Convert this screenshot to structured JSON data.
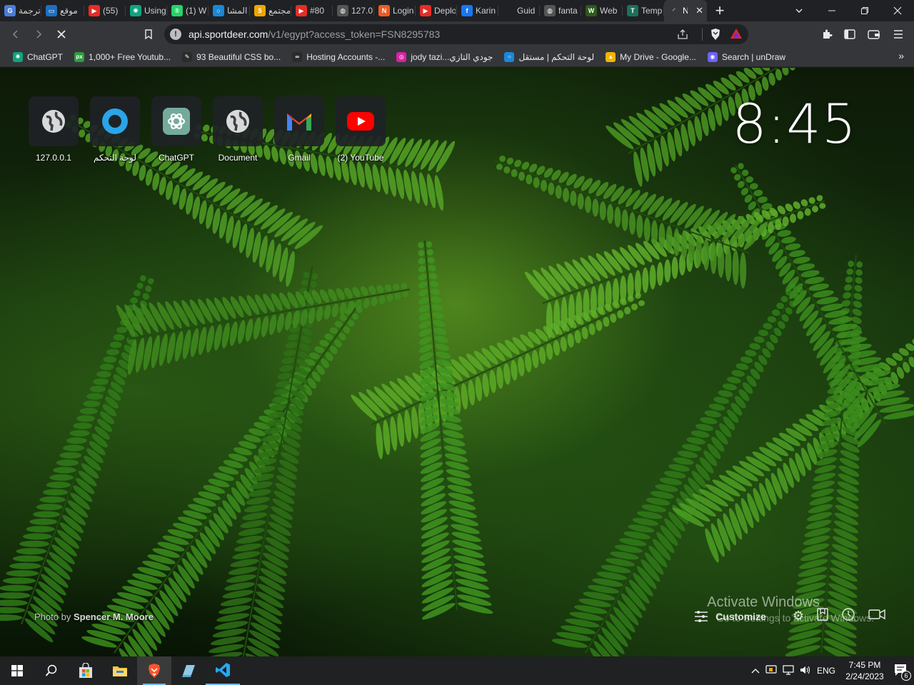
{
  "tabs": [
    {
      "label": "ترجمة",
      "icon": "translate-icon",
      "color": "#4a7dd8",
      "w": 58
    },
    {
      "label": "موقع",
      "icon": "site-icon",
      "color": "#1f6fc0",
      "w": 60
    },
    {
      "label": "(55)",
      "icon": "youtube-icon",
      "color": "#e52d27",
      "w": 58
    },
    {
      "label": "Using",
      "icon": "chatgpt-icon",
      "color": "#10a37f",
      "w": 58
    },
    {
      "label": "(1) W",
      "icon": "whatsapp-icon",
      "color": "#25d366",
      "w": 58
    },
    {
      "label": "المشا",
      "icon": "circle-icon",
      "color": "#1b87d6",
      "w": 58
    },
    {
      "label": "مجتمع",
      "icon": "number-five-icon",
      "color": "#f0a500",
      "w": 58
    },
    {
      "label": "#80",
      "icon": "youtube-icon",
      "color": "#e52d27",
      "w": 58
    },
    {
      "label": "127.0",
      "icon": "globe-icon",
      "color": "#555",
      "w": 58
    },
    {
      "label": "Login",
      "icon": "brand-icon",
      "color": "#f15a24",
      "w": 58
    },
    {
      "label": "Deplo",
      "icon": "youtube-icon",
      "color": "#e52d27",
      "w": 58
    },
    {
      "label": "Karin",
      "icon": "facebook-icon",
      "color": "#1877f2",
      "w": 58
    },
    {
      "label": "Guid",
      "icon": "blank-icon",
      "color": "#202124",
      "w": 58
    },
    {
      "label": "fanta",
      "icon": "globe-icon",
      "color": "#555",
      "w": 58
    },
    {
      "label": "Web",
      "icon": "webflow-icon",
      "color": "#2d5a1b",
      "w": 58
    },
    {
      "label": "Temp",
      "icon": "template-icon",
      "color": "#1e6f5c",
      "w": 58
    },
    {
      "label": "N",
      "icon": "loading-icon",
      "color": "#35363a",
      "w": 60,
      "active": true
    }
  ],
  "toolbar": {
    "url_host": "api.sportdeer.com",
    "url_path": "/v1/egypt?access_token=FSN8295783"
  },
  "bookmarks": [
    {
      "label": "ChatGPT",
      "icon": "chatgpt-icon",
      "color": "#10a37f"
    },
    {
      "label": "1,000+ Free Youtub...",
      "icon": "px-icon",
      "color": "#2e9c3c",
      "glyph": "px"
    },
    {
      "label": "93 Beautiful CSS bo...",
      "icon": "leaf-icon",
      "color": "#2b2b2b",
      "glyph": "✎"
    },
    {
      "label": "Hosting Accounts -...",
      "icon": "hosting-icon",
      "color": "#2b2b2b",
      "glyph": "∞"
    },
    {
      "label": "jody tazi...جودي التازي",
      "icon": "instagram-icon",
      "color": "#d6249f",
      "glyph": "◎"
    },
    {
      "label": "لوحة التحكم | مستقل",
      "icon": "mostaql-icon",
      "color": "#1b87d6",
      "glyph": "○"
    },
    {
      "label": "My Drive - Google...",
      "icon": "google-drive-icon",
      "color": "#f4b400",
      "glyph": "▲"
    },
    {
      "label": "Search | unDraw",
      "icon": "undraw-icon",
      "color": "#6c63ff",
      "glyph": "◉"
    }
  ],
  "top_sites": [
    {
      "label": "127.0.0.1",
      "icon": "globe-icon"
    },
    {
      "label": "لوحة التحكم",
      "icon": "mostaql-icon"
    },
    {
      "label": "ChatGPT",
      "icon": "chatgpt-icon"
    },
    {
      "label": "Document",
      "icon": "globe-icon"
    },
    {
      "label": "Gmail",
      "icon": "gmail-icon"
    },
    {
      "label": "(2) YouTube",
      "icon": "youtube-icon"
    }
  ],
  "clock": "8:45",
  "photo_credit": {
    "prefix": "Photo by",
    "author": "Spencer M. Moore"
  },
  "customize_label": "Customize",
  "watermark": {
    "title": "Activate Windows",
    "subtitle": "Go to Settings to activate Windows."
  },
  "taskbar": {
    "language": "ENG",
    "time": "7:45 PM",
    "date": "2/24/2023",
    "notifications": "6"
  }
}
